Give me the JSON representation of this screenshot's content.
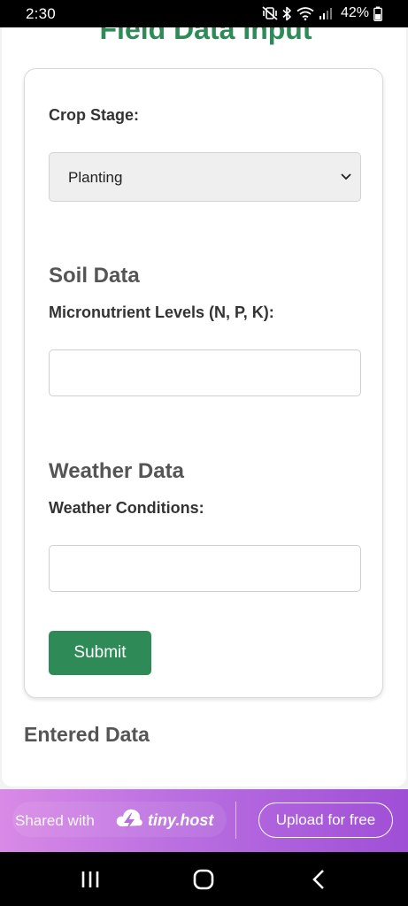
{
  "status_bar": {
    "time": "2:30",
    "battery": "42%",
    "icons": [
      "mute-vibrate-icon",
      "bluetooth-icon",
      "wifi-icon",
      "signal-icon",
      "battery-icon"
    ]
  },
  "page": {
    "title": "Field Data Input",
    "crop_stage": {
      "label": "Crop Stage:",
      "selected": "Planting"
    },
    "soil": {
      "heading": "Soil Data",
      "label": "Micronutrient Levels (N, P, K):",
      "value": ""
    },
    "weather": {
      "heading": "Weather Data",
      "label": "Weather Conditions:",
      "value": ""
    },
    "submit_label": "Submit",
    "entered_heading": "Entered Data"
  },
  "banner": {
    "shared_text": "Shared with",
    "brand": "tiny.host",
    "upload_label": "Upload for free"
  },
  "colors": {
    "accent_green": "#2e8b57",
    "heading_gray": "#555555",
    "banner_start": "#d98ae6",
    "banner_end": "#9f4fd6"
  },
  "nav": {
    "icons": [
      "recents-icon",
      "home-icon",
      "back-icon"
    ]
  }
}
